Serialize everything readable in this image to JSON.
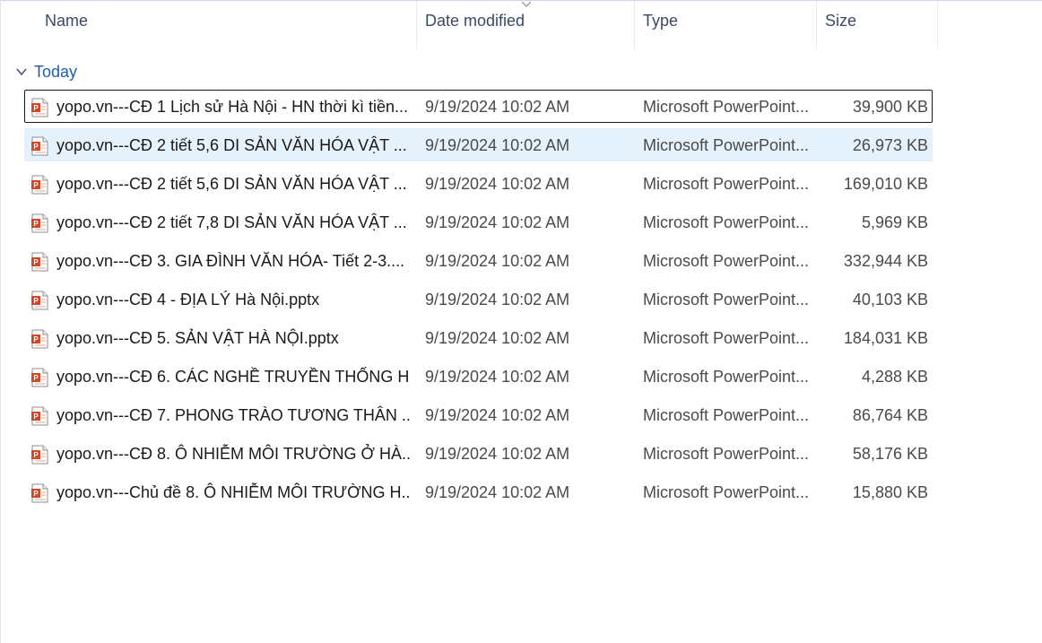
{
  "columns": {
    "name": "Name",
    "date": "Date modified",
    "type": "Type",
    "size": "Size"
  },
  "sort": {
    "column": "date",
    "icon": "sort-chevron-down-icon"
  },
  "group": {
    "label": "Today",
    "icon": "chevron-down-icon"
  },
  "files": [
    {
      "name": "yopo.vn---CĐ 1 Lịch sử Hà Nội - HN thời kì tiền...",
      "date": "9/19/2024 10:02 AM",
      "type": "Microsoft PowerPoint...",
      "size": "39,900 KB",
      "icon": "powerpoint-file-icon",
      "state": "focused"
    },
    {
      "name": "yopo.vn---CĐ 2  tiết 5,6 DI SẢN VĂN HÓA VẬT ...",
      "date": "9/19/2024 10:02 AM",
      "type": "Microsoft PowerPoint...",
      "size": "26,973 KB",
      "icon": "powerpoint-file-icon",
      "state": "hover"
    },
    {
      "name": "yopo.vn---CĐ 2  tiết 5,6 DI SẢN VĂN HÓA VẬT ...",
      "date": "9/19/2024 10:02 AM",
      "type": "Microsoft PowerPoint...",
      "size": "169,010 KB",
      "icon": "powerpoint-file-icon",
      "state": ""
    },
    {
      "name": "yopo.vn---CĐ 2  tiết 7,8 DI SẢN VĂN HÓA VẬT ...",
      "date": "9/19/2024 10:02 AM",
      "type": "Microsoft PowerPoint...",
      "size": "5,969 KB",
      "icon": "powerpoint-file-icon",
      "state": ""
    },
    {
      "name": "yopo.vn---CĐ 3. GIA ĐÌNH VĂN HÓA- Tiết 2-3....",
      "date": "9/19/2024 10:02 AM",
      "type": "Microsoft PowerPoint...",
      "size": "332,944 KB",
      "icon": "powerpoint-file-icon",
      "state": ""
    },
    {
      "name": "yopo.vn---CĐ 4 -  ĐỊA LÝ  Hà Nội.pptx",
      "date": "9/19/2024 10:02 AM",
      "type": "Microsoft PowerPoint...",
      "size": "40,103 KB",
      "icon": "powerpoint-file-icon",
      "state": ""
    },
    {
      "name": "yopo.vn---CĐ 5. SẢN VẬT HÀ NỘI.pptx",
      "date": "9/19/2024 10:02 AM",
      "type": "Microsoft PowerPoint...",
      "size": "184,031 KB",
      "icon": "powerpoint-file-icon",
      "state": ""
    },
    {
      "name": "yopo.vn---CĐ 6. CÁC NGHỀ TRUYỀN THỐNG  H...",
      "date": "9/19/2024 10:02 AM",
      "type": "Microsoft PowerPoint...",
      "size": "4,288 KB",
      "icon": "powerpoint-file-icon",
      "state": ""
    },
    {
      "name": "yopo.vn---CĐ 7. PHONG TRÀO TƯƠNG THÂN ...",
      "date": "9/19/2024 10:02 AM",
      "type": "Microsoft PowerPoint...",
      "size": "86,764 KB",
      "icon": "powerpoint-file-icon",
      "state": ""
    },
    {
      "name": "yopo.vn---CĐ 8. Ô NHIỄM MÔI TRƯỜNG Ở HÀ...",
      "date": "9/19/2024 10:02 AM",
      "type": "Microsoft PowerPoint...",
      "size": "58,176 KB",
      "icon": "powerpoint-file-icon",
      "state": ""
    },
    {
      "name": "yopo.vn---Chủ đề 8. Ô NHIỄM MÔI TRƯỜNG H...",
      "date": "9/19/2024 10:02 AM",
      "type": "Microsoft PowerPoint...",
      "size": "15,880 KB",
      "icon": "powerpoint-file-icon",
      "state": ""
    }
  ]
}
